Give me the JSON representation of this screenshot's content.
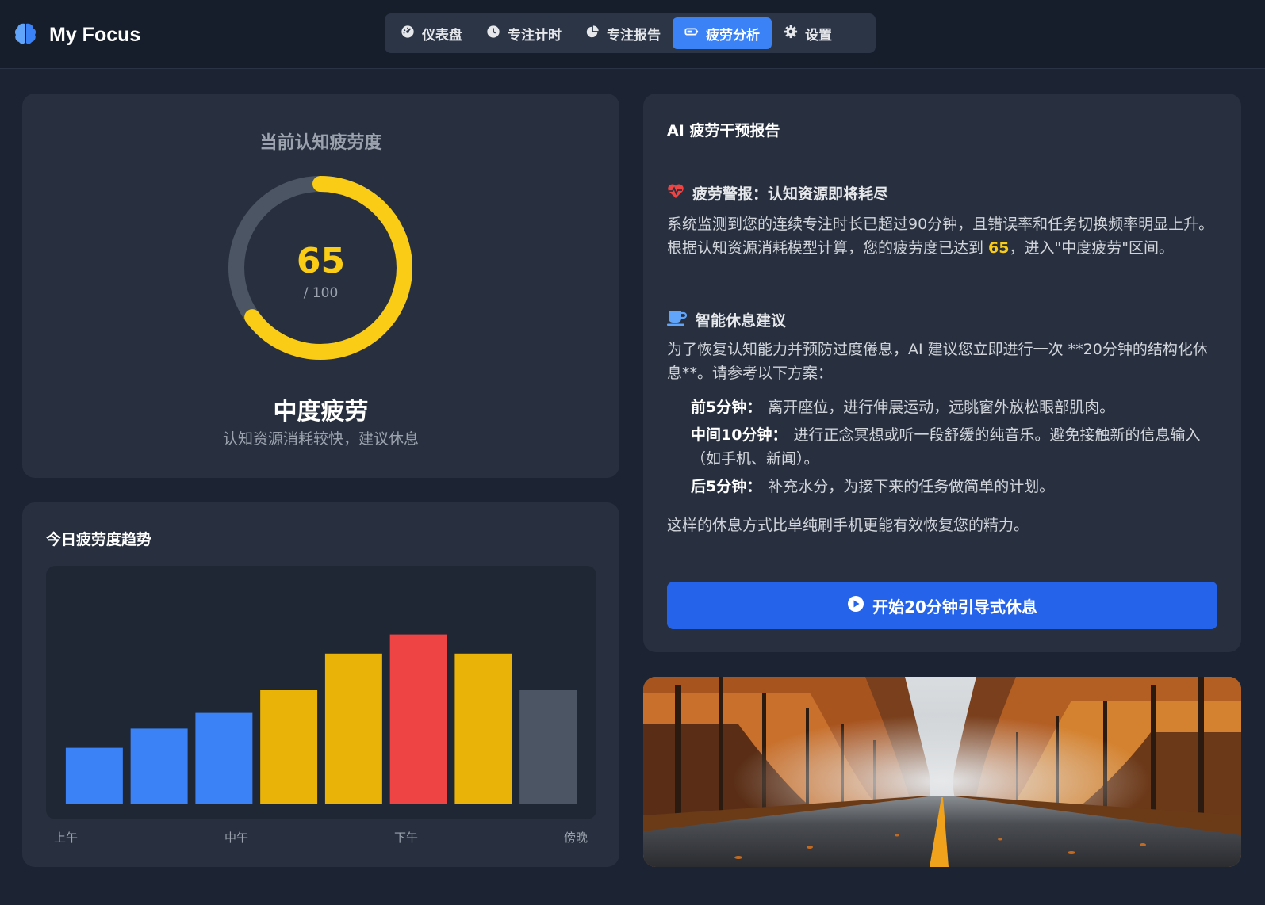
{
  "header": {
    "app_name": "My Focus",
    "nav": [
      {
        "label": "仪表盘",
        "icon": "dashboard-icon",
        "active": false
      },
      {
        "label": "专注计时",
        "icon": "clock-icon",
        "active": false
      },
      {
        "label": "专注报告",
        "icon": "pie-chart-icon",
        "active": false
      },
      {
        "label": "疲劳分析",
        "icon": "battery-icon",
        "active": true
      },
      {
        "label": "设置",
        "icon": "gear-icon",
        "active": false
      }
    ]
  },
  "fatigue": {
    "title": "当前认知疲劳度",
    "value": "65",
    "max_label": "/ 100",
    "fraction": 0.65,
    "level": "中度疲劳",
    "description": "认知资源消耗较快，建议休息",
    "color": "#facc15"
  },
  "trend": {
    "title": "今日疲劳度趋势",
    "x_labels": [
      "上午",
      "中午",
      "下午",
      "傍晚"
    ]
  },
  "chart_data": {
    "type": "bar",
    "title": "今日疲劳度趋势",
    "categories": [
      "",
      "",
      "",
      "",
      "",
      "",
      "",
      ""
    ],
    "values": [
      32,
      43,
      52,
      65,
      86,
      97,
      86,
      65
    ],
    "colors": [
      "#3b82f6",
      "#3b82f6",
      "#3b82f6",
      "#eab308",
      "#eab308",
      "#ef4444",
      "#eab308",
      "#4b5563"
    ],
    "xlabel": "",
    "ylabel": "",
    "ylim": [
      0,
      100
    ],
    "grid": false
  },
  "report": {
    "title": "AI 疲劳干预报告",
    "alert_heading": "疲劳警报：认知资源即将耗尽",
    "alert_text_before": "系统监测到您的连续专注时长已超过90分钟，且错误率和任务切换频率明显上升。根据认知资源消耗模型计算，您的疲劳度已达到 ",
    "alert_highlight": "65",
    "alert_text_after": "，进入\"中度疲劳\"区间。",
    "rest_heading": "智能休息建议",
    "rest_intro": "为了恢复认知能力并预防过度倦息，AI 建议您立即进行一次 **20分钟的结构化休息**。请参考以下方案：",
    "plan": [
      {
        "label": "前5分钟：",
        "text": "离开座位，进行伸展运动，远眺窗外放松眼部肌肉。"
      },
      {
        "label": "中间10分钟：",
        "text": "进行正念冥想或听一段舒缓的纯音乐。避免接触新的信息输入（如手机、新闻）。"
      },
      {
        "label": "后5分钟：",
        "text": "补充水分，为接下来的任务做简单的计划。"
      }
    ],
    "closing": "这样的休息方式比单纯刷手机更能有效恢复您的精力。",
    "cta_label": "开始20分钟引导式休息"
  },
  "colors": {
    "accent": "#3b82f6",
    "cta": "#2563eb",
    "warning": "#facc15",
    "danger": "#ef4444"
  }
}
